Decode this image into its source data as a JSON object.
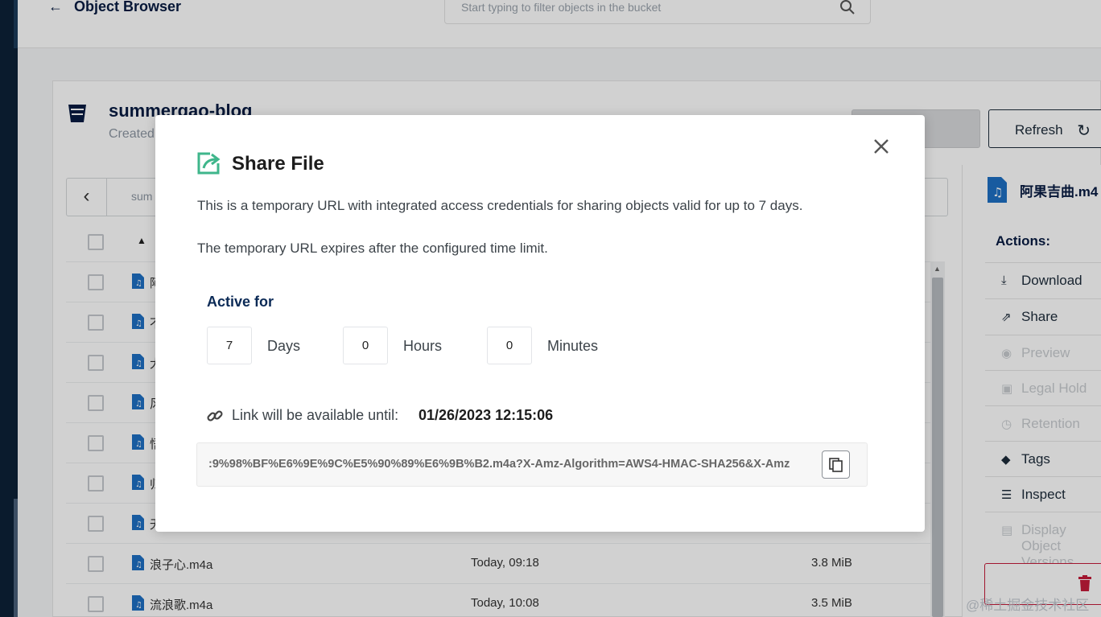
{
  "header": {
    "back_label": "Object Browser",
    "search_placeholder": "Start typing to filter objects in the bucket"
  },
  "bucket": {
    "name": "summergao-blog",
    "created_label": "Created"
  },
  "toolbar": {
    "refresh_label": "Refresh"
  },
  "path": {
    "text": "sum"
  },
  "files": [
    {
      "name": "阿",
      "date": "",
      "size": ""
    },
    {
      "name": "不",
      "date": "",
      "size": ""
    },
    {
      "name": "大",
      "date": "",
      "size": ""
    },
    {
      "name": "风",
      "date": "",
      "size": ""
    },
    {
      "name": "悟",
      "date": "",
      "size": ""
    },
    {
      "name": "归",
      "date": "",
      "size": ""
    },
    {
      "name": "无",
      "date": "",
      "size": ""
    },
    {
      "name": "浪子心.m4a",
      "date": "Today, 09:18",
      "size": "3.8 MiB"
    },
    {
      "name": "流浪歌.m4a",
      "date": "Today, 10:08",
      "size": "3.5 MiB"
    }
  ],
  "side": {
    "file_title": "阿果吉曲.m4",
    "actions_label": "Actions:",
    "actions": [
      {
        "label": "Download",
        "icon": "download-icon",
        "enabled": true
      },
      {
        "label": "Share",
        "icon": "share-icon",
        "enabled": true
      },
      {
        "label": "Preview",
        "icon": "eye-icon",
        "enabled": false
      },
      {
        "label": "Legal Hold",
        "icon": "legal-icon",
        "enabled": false
      },
      {
        "label": "Retention",
        "icon": "retention-icon",
        "enabled": false
      },
      {
        "label": "Tags",
        "icon": "tag-icon",
        "enabled": true
      },
      {
        "label": "Inspect",
        "icon": "inspect-icon",
        "enabled": true
      },
      {
        "label": "Display Object Versions",
        "icon": "versions-icon",
        "enabled": false
      }
    ]
  },
  "watermark": "@稀土掘金技术社区",
  "modal": {
    "title": "Share File",
    "description_1": "This is a temporary URL with integrated access credentials for sharing objects valid for up to 7 days.",
    "description_2": "The temporary URL expires after the configured time limit.",
    "active_for_label": "Active for",
    "days_value": "7",
    "days_label": "Days",
    "hours_value": "0",
    "hours_label": "Hours",
    "minutes_value": "0",
    "minutes_label": "Minutes",
    "availability_label": "Link will be available until:",
    "availability_date": "01/26/2023 12:15:06",
    "url": ":9%98%BF%E6%9E%9C%E5%90%89%E6%9B%B2.m4a?X-Amz-Algorithm=AWS4-HMAC-SHA256&X-Amz"
  },
  "colors": {
    "accent_green": "#3fb68b",
    "brand_navy": "#081c42",
    "danger": "#c51b3a"
  }
}
